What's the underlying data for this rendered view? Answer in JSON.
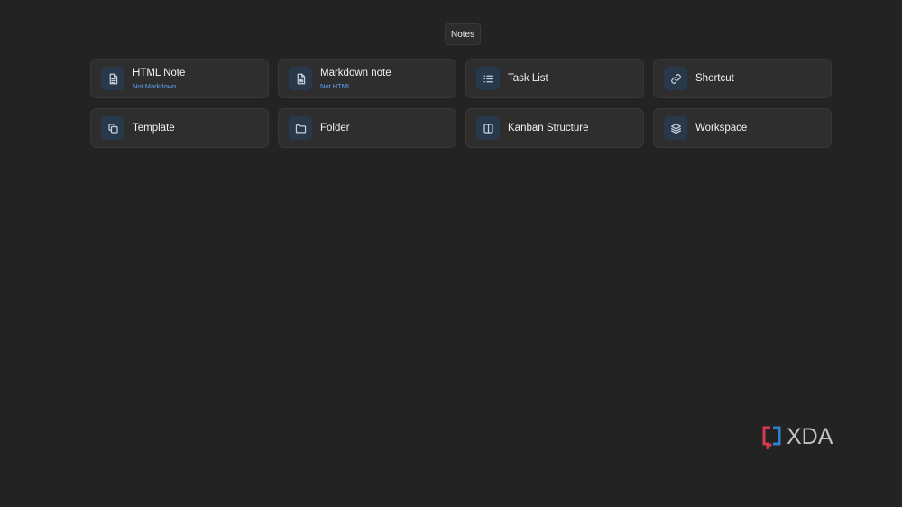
{
  "tooltip": {
    "label": "Notes"
  },
  "cards": [
    {
      "title": "HTML Note",
      "subtitle": "Not Markdown",
      "icon": "document-icon"
    },
    {
      "title": "Markdown note",
      "subtitle": "Not HTML",
      "icon": "markdown-file-icon"
    },
    {
      "title": "Task List",
      "subtitle": "",
      "icon": "list-icon"
    },
    {
      "title": "Shortcut",
      "subtitle": "",
      "icon": "link-icon"
    },
    {
      "title": "Template",
      "subtitle": "",
      "icon": "copy-icon"
    },
    {
      "title": "Folder",
      "subtitle": "",
      "icon": "folder-icon"
    },
    {
      "title": "Kanban Structure",
      "subtitle": "",
      "icon": "columns-icon"
    },
    {
      "title": "Workspace",
      "subtitle": "",
      "icon": "layers-icon"
    }
  ],
  "watermark": {
    "text": "XDA"
  },
  "colors": {
    "background": "#232323",
    "card": "#2e2e2e",
    "icon_bg": "#27394a",
    "subtitle": "#5aa3f0",
    "logo_red": "#d23b4e",
    "logo_blue": "#2f7fd2"
  }
}
